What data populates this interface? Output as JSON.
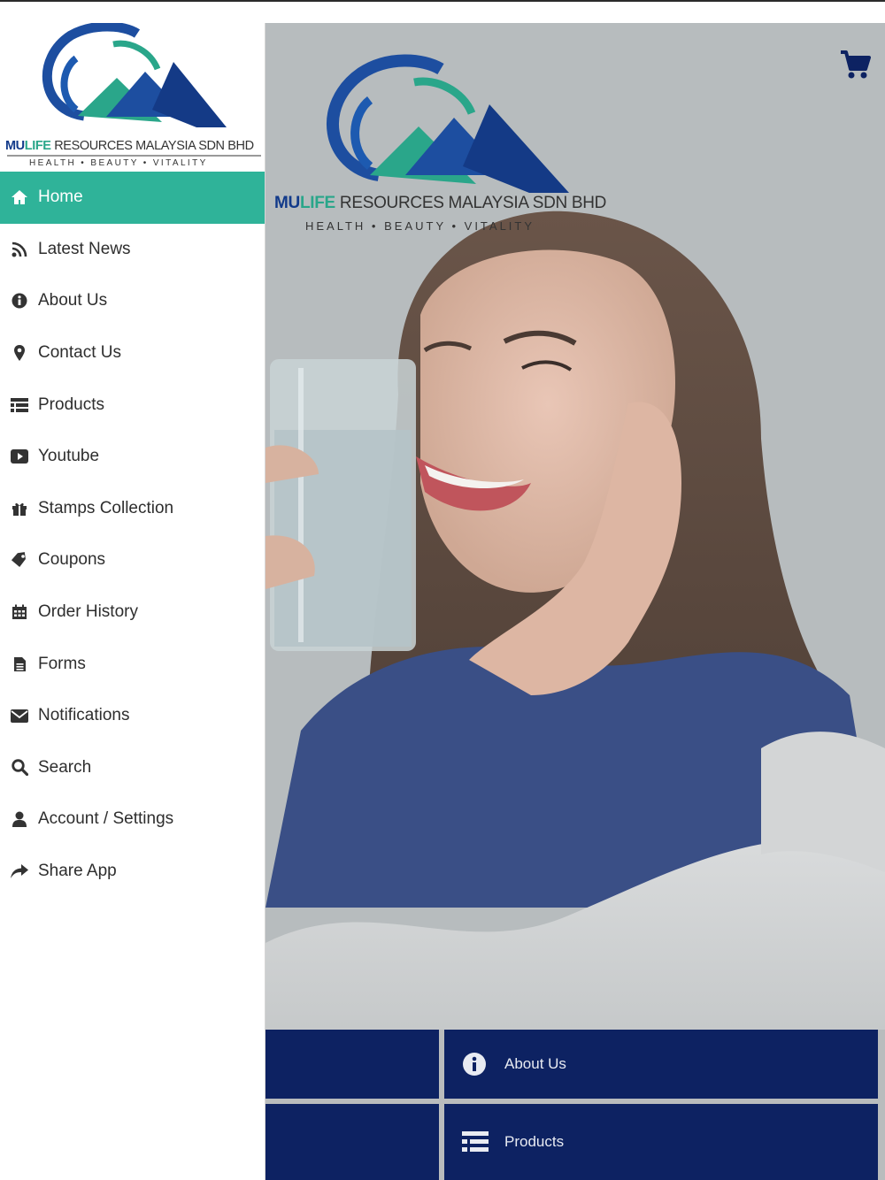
{
  "brand": {
    "name_part1": "MU",
    "name_part2": "LIFE",
    "name_rest": "RESOURCES MALAYSIA SDN BHD",
    "tagline": "HEALTH  •  BEAUTY  •  VITALITY"
  },
  "menu": [
    {
      "label": "Home",
      "icon": "home-icon",
      "active": true
    },
    {
      "label": "Latest News",
      "icon": "rss-icon"
    },
    {
      "label": "About Us",
      "icon": "info-icon"
    },
    {
      "label": "Contact Us",
      "icon": "map-pin-icon"
    },
    {
      "label": "Products",
      "icon": "list-icon"
    },
    {
      "label": "Youtube",
      "icon": "play-icon"
    },
    {
      "label": "Stamps Collection",
      "icon": "gift-icon"
    },
    {
      "label": "Coupons",
      "icon": "tag-icon"
    },
    {
      "label": "Order History",
      "icon": "calendar-icon"
    },
    {
      "label": "Forms",
      "icon": "document-icon"
    },
    {
      "label": "Notifications",
      "icon": "envelope-icon"
    },
    {
      "label": "Search",
      "icon": "search-icon"
    },
    {
      "label": "Account / Settings",
      "icon": "user-icon"
    },
    {
      "label": "Share App",
      "icon": "share-icon"
    }
  ],
  "tiles": {
    "about_label": "About Us",
    "products_label": "Products"
  },
  "colors": {
    "accent": "#2fb399",
    "navy": "#0d2262",
    "brand_blue": "#1d4ea0",
    "brand_green": "#2aa68a"
  }
}
